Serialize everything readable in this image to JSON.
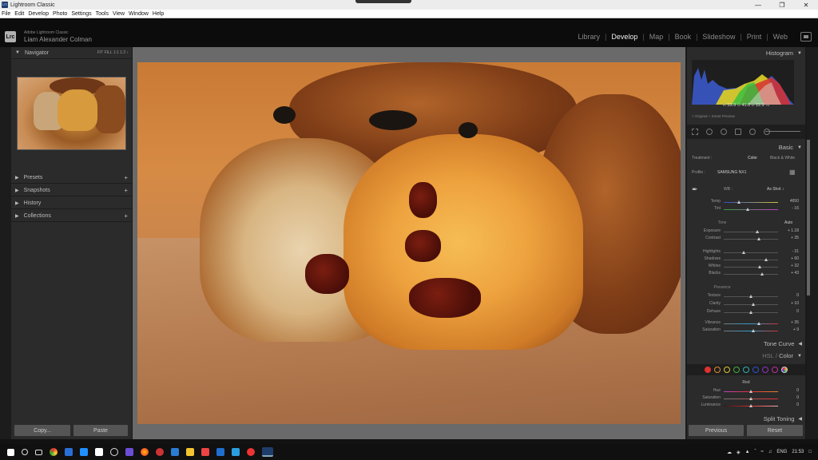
{
  "window": {
    "title": "Lightroom Classic",
    "app_icon": "Lrc"
  },
  "menu": [
    "File",
    "Edit",
    "Develop",
    "Photo",
    "Settings",
    "Tools",
    "View",
    "Window",
    "Help"
  ],
  "identity": {
    "logo": "Lrc",
    "product": "Adobe Lightroom Classic",
    "user": "Liam Alexander Colman"
  },
  "modules": {
    "items": [
      "Library",
      "Develop",
      "Map",
      "Book",
      "Slideshow",
      "Print",
      "Web"
    ],
    "active": "Develop",
    "separator": "|"
  },
  "left": {
    "navigator": {
      "title": "Navigator",
      "zoom": "FIT  FILL  1:1  1:2 ↕"
    },
    "panels": [
      {
        "label": "Presets",
        "plus": "+"
      },
      {
        "label": "Snapshots",
        "plus": "+"
      },
      {
        "label": "History",
        "plus": ""
      },
      {
        "label": "Collections",
        "plus": "+"
      }
    ],
    "copy": "Copy...",
    "paste": "Paste"
  },
  "right": {
    "histogram_title": "Histogram",
    "readout": {
      "r_label": "R",
      "r": "53.9",
      "g_label": "G",
      "g": "41.0",
      "b_label": "B",
      "b": "12.9",
      "pct": "%"
    },
    "original": "Original + Smart Preview",
    "basic": {
      "title": "Basic",
      "treatment_label": "Treatment :",
      "color": "Color",
      "bw": "Black & White",
      "profile_label": "Profile :",
      "profile": "SAMSUNG NX1",
      "wb_label": "WB :",
      "wb": "As Shot ↕",
      "temp_label": "Temp",
      "temp": "4650",
      "tint_label": "Tint",
      "tint": "- 16",
      "tone_label": "Tone",
      "auto": "Auto",
      "exposure_label": "Exposure",
      "exposure": "+ 1.18",
      "contrast_label": "Contrast",
      "contrast": "+ 35",
      "highlights_label": "Highlights",
      "highlights": "- 31",
      "shadows_label": "Shadows",
      "shadows": "+ 60",
      "whites_label": "Whites",
      "whites": "+ 32",
      "blacks_label": "Blacks",
      "blacks": "+ 43",
      "presence_label": "Presence",
      "texture_label": "Texture",
      "texture": "0",
      "clarity_label": "Clarity",
      "clarity": "+ 10",
      "dehaze_label": "Dehaze",
      "dehaze": "0",
      "vibrance_label": "Vibrance",
      "vibrance": "+ 35",
      "saturation_label": "Saturation",
      "saturation": "+ 9"
    },
    "tone_curve": "Tone Curve",
    "hsl": {
      "title": "HSL / Color",
      "hsl_label": "HSL",
      "sep": " / ",
      "color_label": "Color",
      "swatch_colors": [
        "#e03030",
        "#e08a30",
        "#d8c830",
        "#40b040",
        "#30b0b0",
        "#3050d0",
        "#9030c0",
        "#c030a0"
      ],
      "channel": "Red",
      "hue_label": "Hue",
      "hue": "0",
      "sat_label": "Saturation",
      "sat": "0",
      "lum_label": "Luminance",
      "lum": "0"
    },
    "split_toning": "Split Toning",
    "previous": "Previous",
    "reset": "Reset"
  },
  "taskbar": {
    "lang": "ENG",
    "time": "21:53"
  }
}
